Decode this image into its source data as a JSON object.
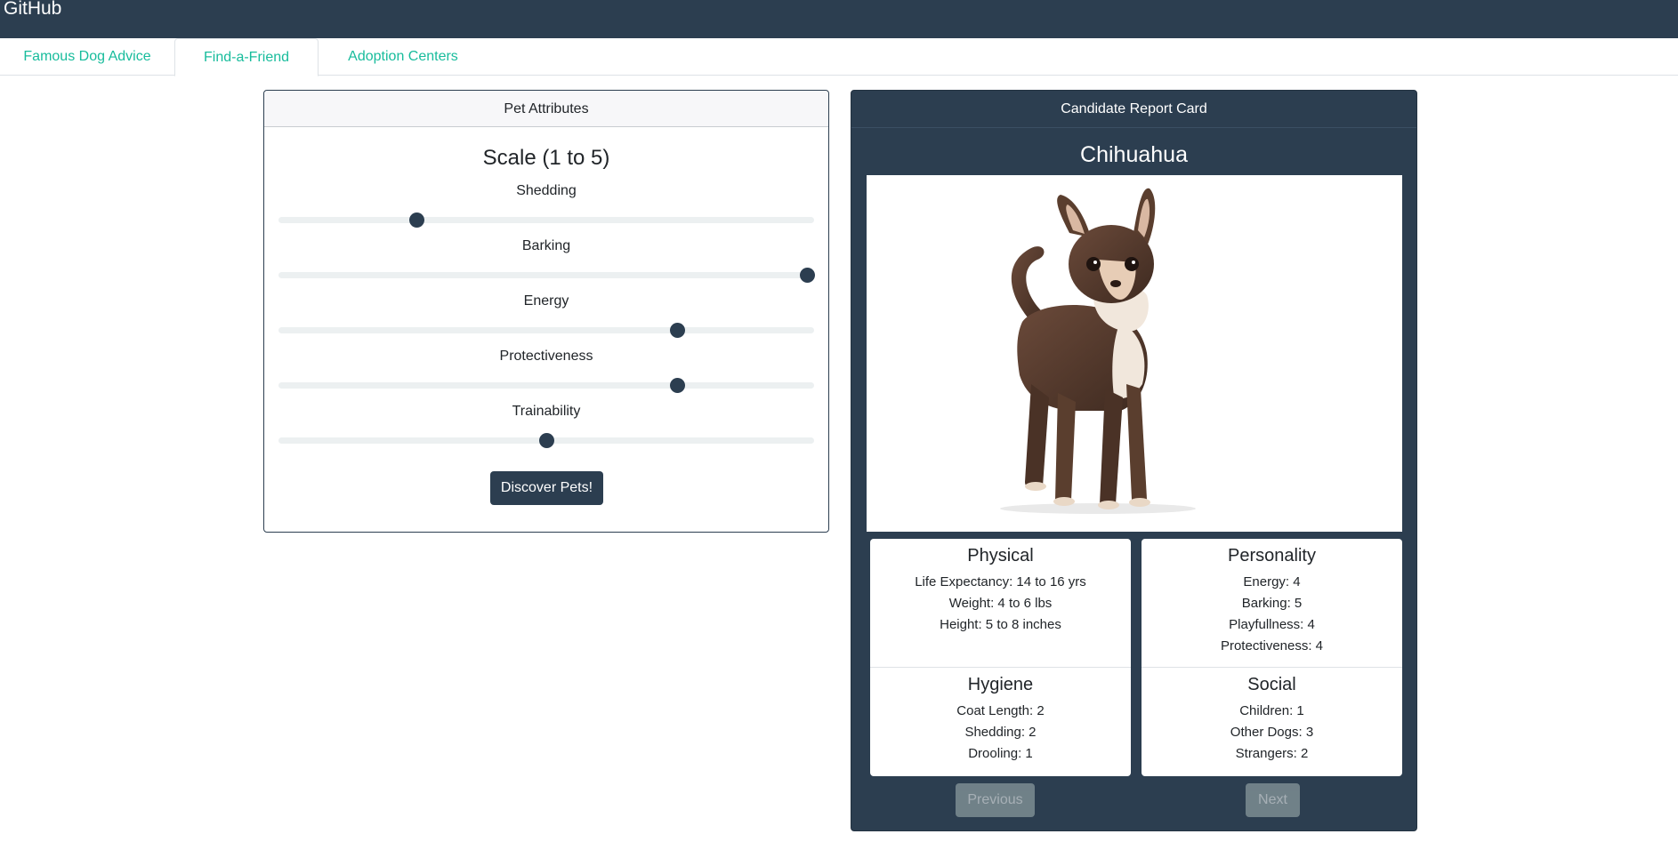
{
  "topbar": {
    "brand": "GitHub"
  },
  "tabs": [
    {
      "label": "Famous Dog Advice",
      "active": false
    },
    {
      "label": "Find-a-Friend",
      "active": true
    },
    {
      "label": "Adoption Centers",
      "active": false
    }
  ],
  "attributes": {
    "header": "Pet Attributes",
    "scale_title": "Scale (1 to 5)",
    "sliders": [
      {
        "label": "Shedding",
        "value": 2
      },
      {
        "label": "Barking",
        "value": 5
      },
      {
        "label": "Energy",
        "value": 4
      },
      {
        "label": "Protectiveness",
        "value": 4
      },
      {
        "label": "Trainability",
        "value": 3
      }
    ],
    "slider_min": 1,
    "slider_max": 5,
    "discover_label": "Discover Pets!"
  },
  "report": {
    "header": "Candidate Report Card",
    "breed": "Chihuahua",
    "physical": {
      "title": "Physical",
      "lines": [
        "Life Expectancy: 14 to 16 yrs",
        "Weight: 4 to 6 lbs",
        "Height: 5 to 8 inches"
      ]
    },
    "personality": {
      "title": "Personality",
      "lines": [
        "Energy: 4",
        "Barking: 5",
        "Playfullness: 4",
        "Protectiveness: 4"
      ]
    },
    "hygiene": {
      "title": "Hygiene",
      "lines": [
        "Coat Length: 2",
        "Shedding: 2",
        "Drooling: 1"
      ]
    },
    "social": {
      "title": "Social",
      "lines": [
        "Children: 1",
        "Other Dogs: 3",
        "Strangers: 2"
      ]
    },
    "prev_label": "Previous",
    "next_label": "Next"
  },
  "colors": {
    "primary": "#2c3e50",
    "accent": "#18bc9c",
    "disabled": "#95a5a6"
  }
}
